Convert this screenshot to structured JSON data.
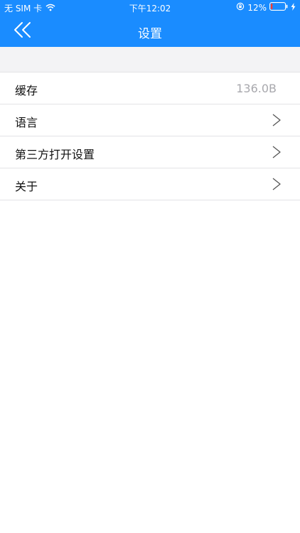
{
  "status_bar": {
    "carrier": "无 SIM 卡",
    "time": "下午12:02",
    "battery_percent": "12%",
    "battery_level": 0.12,
    "icons": [
      "wifi-icon",
      "orientation-lock-icon",
      "battery-icon",
      "charging-icon"
    ]
  },
  "nav": {
    "title": "设置",
    "back_icon": "double-chevron-left-icon"
  },
  "settings": {
    "items": [
      {
        "label": "缓存",
        "value": "136.0B"
      },
      {
        "label": "语言"
      },
      {
        "label": "第三方打开设置"
      },
      {
        "label": "关于"
      }
    ]
  },
  "colors": {
    "brand": "#1a8cff",
    "section_bg": "#f3f3f5",
    "divider": "#e3e3e6",
    "secondary_text": "#a8a8ad",
    "battery_low": "#ff3b30"
  }
}
